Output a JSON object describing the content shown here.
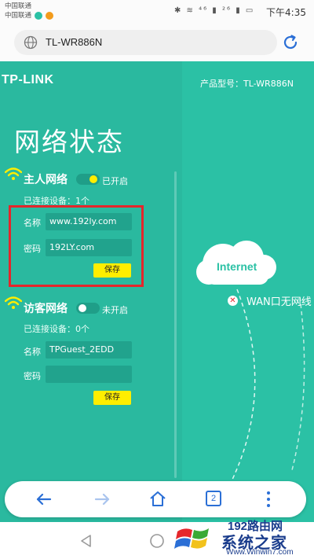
{
  "status_bar": {
    "carrier_1": "中国联通",
    "carrier_2": "中国联通",
    "time": "下午4:35",
    "icons": "✱ ≋ ⁴⁶ ▮ ²⁶ ▮ ▭"
  },
  "address_bar": {
    "url": "TL-WR886N",
    "icon": "globe-icon",
    "reload_icon": "reload-icon"
  },
  "page": {
    "logo": "TP-LINK",
    "model": "产品型号：TL-WR886N",
    "heading": "网络状态",
    "host_network": {
      "title": "主人网络",
      "toggle_state": "已开启",
      "toggle_on": true,
      "connected": "已连接设备：1个",
      "name_label": "名称",
      "name_value": "www.192ly.com",
      "password_label": "密码",
      "password_value": "192LY.com",
      "save": "保存"
    },
    "guest_network": {
      "title": "访客网络",
      "toggle_state": "未开启",
      "toggle_on": false,
      "connected": "已连接设备：0个",
      "name_label": "名称",
      "name_value": "TPGuest_2EDD",
      "password_label": "密码",
      "password_value": "",
      "save": "保存"
    },
    "diagram": {
      "internet": "Internet",
      "wan_status": "WAN口无网线"
    }
  },
  "browser_toolbar": {
    "back": "back-icon",
    "forward": "forward-icon",
    "home": "home-icon",
    "tabs": "2",
    "menu": "more-icon"
  },
  "watermark": {
    "brand": "192路由网",
    "sub": "系统之家",
    "url": "Www.Winwin7.com",
    "logo_text": "Win"
  },
  "colors": {
    "teal": "#2bc1a5",
    "panel": "#2ab99f",
    "field": "#21a38d",
    "save_button": "#ffee00",
    "highlight": "#e5262b",
    "accent_blue": "#2b6fd6"
  }
}
